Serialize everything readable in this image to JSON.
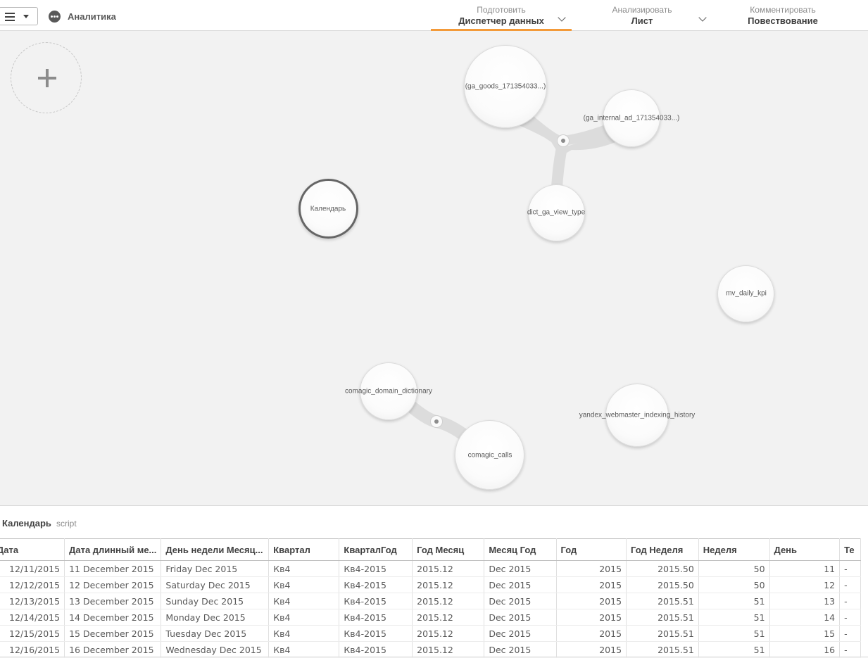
{
  "header": {
    "app_title": "Аналитика",
    "tabs": [
      {
        "sub": "Подготовить",
        "main": "Диспетчер данных",
        "active": true
      },
      {
        "sub": "Анализировать",
        "main": "Лист",
        "active": false
      },
      {
        "sub": "Комментировать",
        "main": "Повествование",
        "active": false
      }
    ]
  },
  "canvas": {
    "tables": [
      {
        "name": "(ga_goods_171354033...)"
      },
      {
        "name": "(ga_internal_ad_171354033...)"
      },
      {
        "name": "dict_ga_view_type"
      },
      {
        "name": "Календарь",
        "selected": true
      },
      {
        "name": "mv_daily_kpi"
      },
      {
        "name": "comagic_domain_dictionary"
      },
      {
        "name": "comagic_calls"
      },
      {
        "name": "yandex_webmaster_indexing_history"
      }
    ]
  },
  "preview": {
    "table_name": "Календарь",
    "source": "script",
    "columns": [
      "Дата",
      "Дата длинный ме...",
      "День недели Месяц...",
      "Квартал",
      "КварталГод",
      "Год Месяц",
      "Месяц Год",
      "Год",
      "Год Неделя",
      "Неделя",
      "День",
      "Те"
    ],
    "rows": [
      [
        "12/11/2015",
        "11 December 2015",
        "Friday Dec 2015",
        "Кв4",
        "Кв4-2015",
        "2015.12",
        "Dec 2015",
        "2015",
        "2015.50",
        "50",
        "11",
        "-"
      ],
      [
        "12/12/2015",
        "12 December 2015",
        "Saturday Dec 2015",
        "Кв4",
        "Кв4-2015",
        "2015.12",
        "Dec 2015",
        "2015",
        "2015.50",
        "50",
        "12",
        "-"
      ],
      [
        "12/13/2015",
        "13 December 2015",
        "Sunday Dec 2015",
        "Кв4",
        "Кв4-2015",
        "2015.12",
        "Dec 2015",
        "2015",
        "2015.51",
        "51",
        "13",
        "-"
      ],
      [
        "12/14/2015",
        "14 December 2015",
        "Monday Dec 2015",
        "Кв4",
        "Кв4-2015",
        "2015.12",
        "Dec 2015",
        "2015",
        "2015.51",
        "51",
        "14",
        "-"
      ],
      [
        "12/15/2015",
        "15 December 2015",
        "Tuesday Dec 2015",
        "Кв4",
        "Кв4-2015",
        "2015.12",
        "Dec 2015",
        "2015",
        "2015.51",
        "51",
        "15",
        "-"
      ],
      [
        "12/16/2015",
        "16 December 2015",
        "Wednesday Dec 2015",
        "Кв4",
        "Кв4-2015",
        "2015.12",
        "Dec 2015",
        "2015",
        "2015.51",
        "51",
        "16",
        "-"
      ]
    ]
  },
  "colors": {
    "accent": "#f39a39",
    "selected_border": "#666666"
  }
}
